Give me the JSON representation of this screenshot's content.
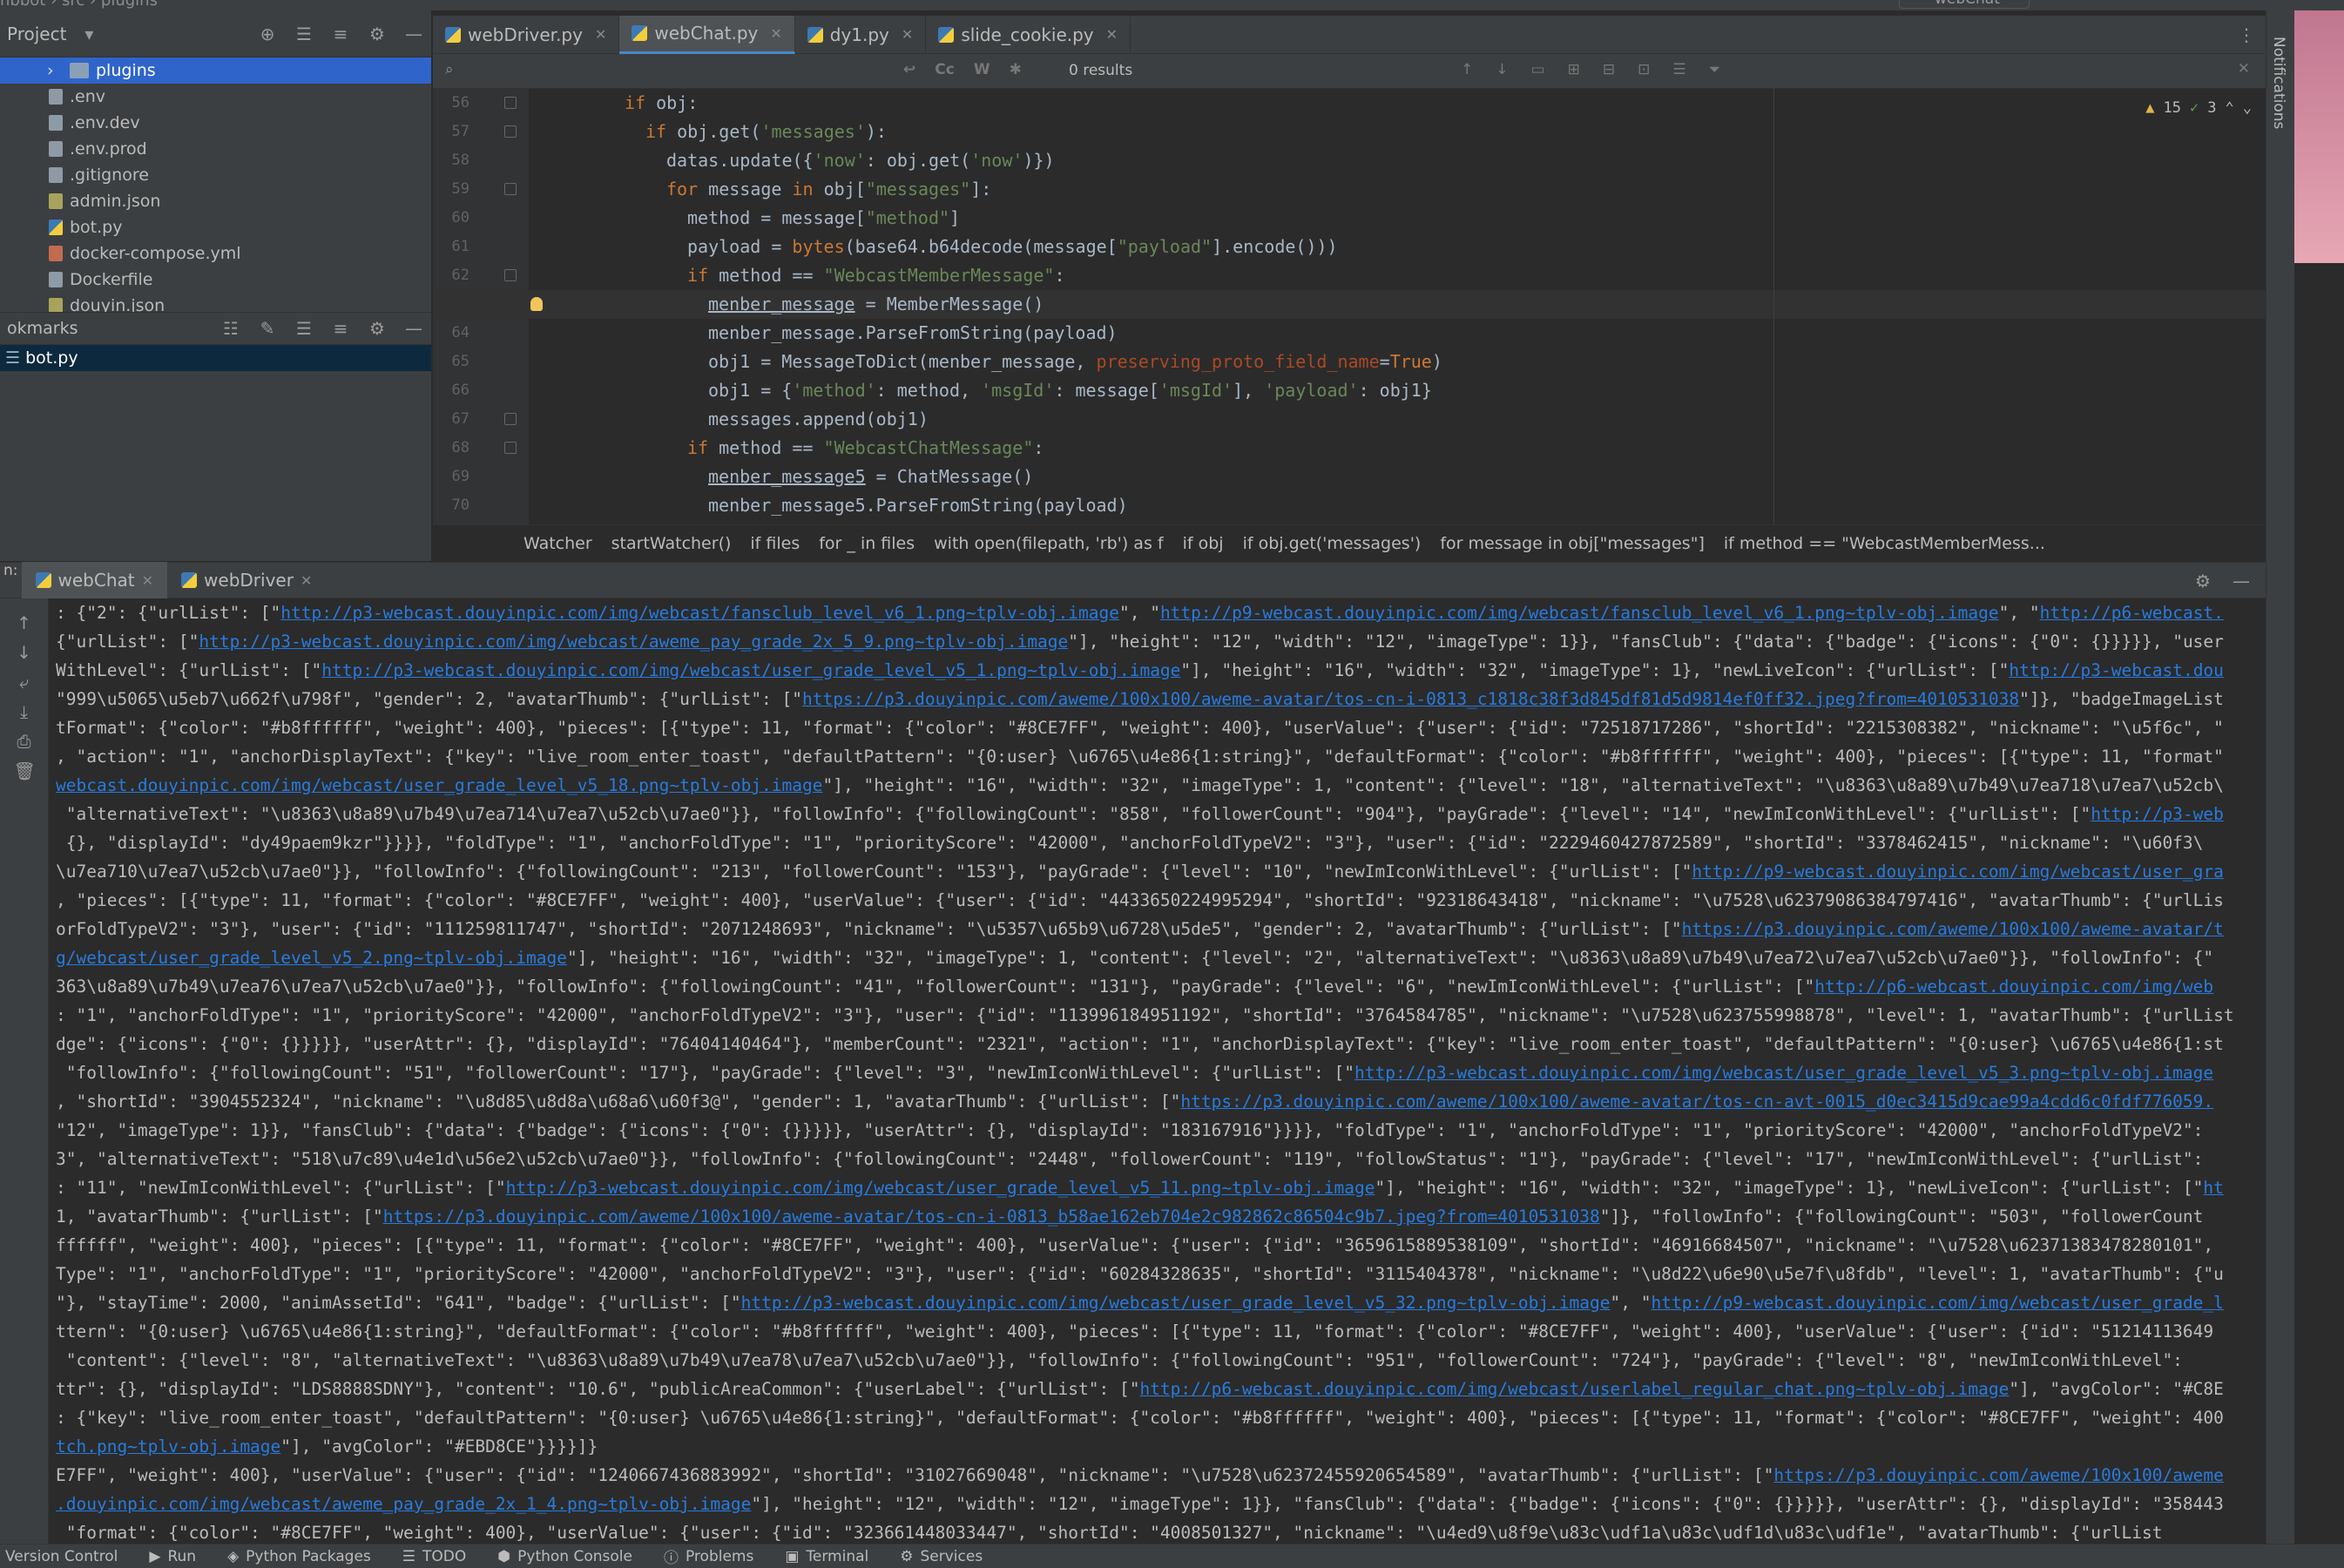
{
  "titlebar": {
    "breadcrumb": "nbbot  ›  src  ›  plugins",
    "run_config": "webChat"
  },
  "project": {
    "title": "Project",
    "items": [
      {
        "label": "plugins",
        "type": "folder",
        "selected": true
      },
      {
        "label": ".env",
        "type": "file"
      },
      {
        "label": ".env.dev",
        "type": "file"
      },
      {
        "label": ".env.prod",
        "type": "file"
      },
      {
        "label": ".gitignore",
        "type": "file"
      },
      {
        "label": "admin.json",
        "type": "json"
      },
      {
        "label": "bot.py",
        "type": "py"
      },
      {
        "label": "docker-compose.yml",
        "type": "yml"
      },
      {
        "label": "Dockerfile",
        "type": "file"
      },
      {
        "label": "douyin.json",
        "type": "json"
      }
    ]
  },
  "bookmarks": {
    "title": "okmarks",
    "items": [
      {
        "label": "bot.py"
      }
    ]
  },
  "editor": {
    "tabs": [
      {
        "label": "webDriver.py",
        "active": false
      },
      {
        "label": "webChat.py",
        "active": true
      },
      {
        "label": "dy1.py",
        "active": false
      },
      {
        "label": "slide_cookie.py",
        "active": false
      }
    ],
    "search": {
      "results": "0 results",
      "opt_cc": "Cc",
      "opt_w": "W"
    },
    "inspections": {
      "warnings": "15",
      "ok": "3"
    },
    "current_line": "63",
    "lines": [
      {
        "n": "56",
        "indent": 8,
        "html": "<span class=\"kw\">if</span> obj:"
      },
      {
        "n": "57",
        "indent": 10,
        "html": "<span class=\"kw\">if</span> obj.get(<span class=\"st\">'messages'</span>):"
      },
      {
        "n": "58",
        "indent": 12,
        "html": "datas.update({<span class=\"st\">'now'</span>: obj.get(<span class=\"st\">'now'</span>)})"
      },
      {
        "n": "59",
        "indent": 12,
        "html": "<span class=\"kw\">for</span> message <span class=\"kw\">in</span> obj[<span class=\"st\">\"messages\"</span>]:"
      },
      {
        "n": "60",
        "indent": 14,
        "html": "method = message[<span class=\"st\">\"method\"</span>]"
      },
      {
        "n": "61",
        "indent": 14,
        "html": "payload = <span class=\"kw\">bytes</span>(base64.b64decode(message[<span class=\"st\">\"payload\"</span>].encode()))"
      },
      {
        "n": "62",
        "indent": 14,
        "html": "<span class=\"kw\">if</span> method == <span class=\"st\">\"WebcastMemberMessage\"</span>:"
      },
      {
        "n": "63",
        "indent": 16,
        "html": "<span class=\"ul\">menber_message</span> = MemberMessage()"
      },
      {
        "n": "64",
        "indent": 16,
        "html": "menber_message.ParseFromString(payload)"
      },
      {
        "n": "65",
        "indent": 16,
        "html": "obj1 = MessageToDict(menber_message, <span class=\"pm\">preserving_proto_field_name</span>=<span class=\"kw\">True</span>)"
      },
      {
        "n": "66",
        "indent": 16,
        "html": "obj1 = {<span class=\"st\">'method'</span>: method, <span class=\"st\">'msgId'</span>: message[<span class=\"st\">'msgId'</span>], <span class=\"st\">'payload'</span>: obj1}"
      },
      {
        "n": "67",
        "indent": 16,
        "html": "messages.append(obj1)"
      },
      {
        "n": "68",
        "indent": 14,
        "html": "<span class=\"kw\">if</span> method == <span class=\"st\">\"WebcastChatMessage\"</span>:"
      },
      {
        "n": "69",
        "indent": 16,
        "html": "<span class=\"ul\">menber_message5</span> = ChatMessage()"
      },
      {
        "n": "70",
        "indent": 16,
        "html": "menber_message5.ParseFromString(payload)"
      }
    ],
    "breadcrumbs": [
      "Watcher",
      "startWatcher()",
      "if files",
      "for _ in files",
      "with open(filepath, 'rb') as f",
      "if obj",
      "if obj.get('messages')",
      "for message in obj[\"messages\"]",
      "if method == \"WebcastMemberMess..."
    ]
  },
  "run": {
    "prefix": "n:",
    "tabs": [
      {
        "label": "webChat",
        "active": true
      },
      {
        "label": "webDriver",
        "active": false
      }
    ],
    "console_lines": [
      ": {\"2\": {\"urlList\": [\"<a>http://p3-webcast.douyinpic.com/img/webcast/fansclub_level_v6_1.png~tplv-obj.image</a>\", \"<a>http://p9-webcast.douyinpic.com/img/webcast/fansclub_level_v6_1.png~tplv-obj.image</a>\", \"<a>http://p6-webcast.</a>",
      "{\"urlList\": [\"<a>http://p3-webcast.douyinpic.com/img/webcast/aweme_pay_grade_2x_5_9.png~tplv-obj.image</a>\"], \"height\": \"12\", \"width\": \"12\", \"imageType\": 1}}, \"fansClub\": {\"data\": {\"badge\": {\"icons\": {\"0\": {}}}}}, \"user",
      "WithLevel\": {\"urlList\": [\"<a>http://p3-webcast.douyinpic.com/img/webcast/user_grade_level_v5_1.png~tplv-obj.image</a>\"], \"height\": \"16\", \"width\": \"32\", \"imageType\": 1}, \"newLiveIcon\": {\"urlList\": [\"<a>http://p3-webcast.dou</a>",
      "\"999\\u5065\\u5eb7\\u662f\\u798f\", \"gender\": 2, \"avatarThumb\": {\"urlList\": [\"<a>https://p3.douyinpic.com/aweme/100x100/aweme-avatar/tos-cn-i-0813_c1818c38f3d845df81d5d9814ef0ff32.jpeg?from=4010531038</a>\"]}, \"badgeImageList",
      "tFormat\": {\"color\": \"#b8ffffff\", \"weight\": 400}, \"pieces\": [{\"type\": 11, \"format\": {\"color\": \"#8CE7FF\", \"weight\": 400}, \"userValue\": {\"user\": {\"id\": \"72518717286\", \"shortId\": \"2215308382\", \"nickname\": \"\\u5f6c\", \"",
      ", \"action\": \"1\", \"anchorDisplayText\": {\"key\": \"live_room_enter_toast\", \"defaultPattern\": \"{0:user} \\u6765\\u4e86{1:string}\", \"defaultFormat\": {\"color\": \"#b8ffffff\", \"weight\": 400}, \"pieces\": [{\"type\": 11, \"format\"",
      "<a>webcast.douyinpic.com/img/webcast/user_grade_level_v5_18.png~tplv-obj.image</a>\"], \"height\": \"16\", \"width\": \"32\", \"imageType\": 1, \"content\": {\"level\": \"18\", \"alternativeText\": \"\\u8363\\u8a89\\u7b49\\u7ea718\\u7ea7\\u52cb\\",
      " \"alternativeText\": \"\\u8363\\u8a89\\u7b49\\u7ea714\\u7ea7\\u52cb\\u7ae0\"}}, \"followInfo\": {\"followingCount\": \"858\", \"followerCount\": \"904\"}, \"payGrade\": {\"level\": \"14\", \"newImIconWithLevel\": {\"urlList\": [\"<a>http://p3-web</a>",
      " {}, \"displayId\": \"dy49paem9kzr\"}}}}, \"foldType\": \"1\", \"anchorFoldType\": \"1\", \"priorityScore\": \"42000\", \"anchorFoldTypeV2\": \"3\"}, \"user\": {\"id\": \"2229460427872589\", \"shortId\": \"3378462415\", \"nickname\": \"\\u60f3\\",
      "\\u7ea710\\u7ea7\\u52cb\\u7ae0\"}}, \"followInfo\": {\"followingCount\": \"213\", \"followerCount\": \"153\"}, \"payGrade\": {\"level\": \"10\", \"newImIconWithLevel\": {\"urlList\": [\"<a>http://p9-webcast.douyinpic.com/img/webcast/user_gra</a>",
      ", \"pieces\": [{\"type\": 11, \"format\": {\"color\": \"#8CE7FF\", \"weight\": 400}, \"userValue\": {\"user\": {\"id\": \"4433650224995294\", \"shortId\": \"92318643418\", \"nickname\": \"\\u7528\\u62379086384797416\", \"avatarThumb\": {\"urlLis",
      "orFoldTypeV2\": \"3\"}, \"user\": {\"id\": \"111259811747\", \"shortId\": \"2071248693\", \"nickname\": \"\\u5357\\u65b9\\u6728\\u5de5\", \"gender\": 2, \"avatarThumb\": {\"urlList\": [\"<a>https://p3.douyinpic.com/aweme/100x100/aweme-avatar/t</a>",
      "<a>g/webcast/user_grade_level_v5_2.png~tplv-obj.image</a>\"], \"height\": \"16\", \"width\": \"32\", \"imageType\": 1, \"content\": {\"level\": \"2\", \"alternativeText\": \"\\u8363\\u8a89\\u7b49\\u7ea72\\u7ea7\\u52cb\\u7ae0\"}}, \"followInfo\": {\"",
      "363\\u8a89\\u7b49\\u7ea76\\u7ea7\\u52cb\\u7ae0\"}}, \"followInfo\": {\"followingCount\": \"41\", \"followerCount\": \"131\"}, \"payGrade\": {\"level\": \"6\", \"newImIconWithLevel\": {\"urlList\": [\"<a>http://p6-webcast.douyinpic.com/img/web</a>",
      ": \"1\", \"anchorFoldType\": \"1\", \"priorityScore\": \"42000\", \"anchorFoldTypeV2\": \"3\"}, \"user\": {\"id\": \"113996184951192\", \"shortId\": \"3764584785\", \"nickname\": \"\\u7528\\u623755998878\", \"level\": 1, \"avatarThumb\": {\"urlList",
      "dge\": {\"icons\": {\"0\": {}}}}}, \"userAttr\": {}, \"displayId\": \"76404140464\"}, \"memberCount\": \"2321\", \"action\": \"1\", \"anchorDisplayText\": {\"key\": \"live_room_enter_toast\", \"defaultPattern\": \"{0:user} \\u6765\\u4e86{1:st",
      " \"followInfo\": {\"followingCount\": \"51\", \"followerCount\": \"17\"}, \"payGrade\": {\"level\": \"3\", \"newImIconWithLevel\": {\"urlList\": [\"<a>http://p3-webcast.douyinpic.com/img/webcast/user_grade_level_v5_3.png~tplv-obj.image</a>",
      ", \"shortId\": \"3904552324\", \"nickname\": \"\\u8d85\\u8d8a\\u68a6\\u60f3@\", \"gender\": 1, \"avatarThumb\": {\"urlList\": [\"<a>https://p3.douyinpic.com/aweme/100x100/aweme-avatar/tos-cn-avt-0015_d0ec3415d9cae99a4cdd6c0fdf776059.</a>",
      "\"12\", \"imageType\": 1}}, \"fansClub\": {\"data\": {\"badge\": {\"icons\": {\"0\": {}}}}}, \"userAttr\": {}, \"displayId\": \"183167916\"}}}}, \"foldType\": \"1\", \"anchorFoldType\": \"1\", \"priorityScore\": \"42000\", \"anchorFoldTypeV2\":",
      "3\", \"alternativeText\": \"518\\u7c89\\u4e1d\\u56e2\\u52cb\\u7ae0\"}}, \"followInfo\": {\"followingCount\": \"2448\", \"followerCount\": \"119\", \"followStatus\": \"1\"}, \"payGrade\": {\"level\": \"17\", \"newImIconWithLevel\": {\"urlList\":",
      ": \"11\", \"newImIconWithLevel\": {\"urlList\": [\"<a>http://p3-webcast.douyinpic.com/img/webcast/user_grade_level_v5_11.png~tplv-obj.image</a>\"], \"height\": \"16\", \"width\": \"32\", \"imageType\": 1}, \"newLiveIcon\": {\"urlList\": [\"<a>ht</a>",
      "1, \"avatarThumb\": {\"urlList\": [\"<a>https://p3.douyinpic.com/aweme/100x100/aweme-avatar/tos-cn-i-0813_b58ae162eb704e2c982862c86504c9b7.jpeg?from=4010531038</a>\"]}, \"followInfo\": {\"followingCount\": \"503\", \"followerCount",
      "ffffff\", \"weight\": 400}, \"pieces\": [{\"type\": 11, \"format\": {\"color\": \"#8CE7FF\", \"weight\": 400}, \"userValue\": {\"user\": {\"id\": \"3659615889538109\", \"shortId\": \"46916684507\", \"nickname\": \"\\u7528\\u62371383478280101\",",
      "Type\": \"1\", \"anchorFoldType\": \"1\", \"priorityScore\": \"42000\", \"anchorFoldTypeV2\": \"3\"}, \"user\": {\"id\": \"60284328635\", \"shortId\": \"3115404378\", \"nickname\": \"\\u8d22\\u6e90\\u5e7f\\u8fdb\", \"level\": 1, \"avatarThumb\": {\"u",
      "\"}, \"stayTime\": 2000, \"animAssetId\": \"641\", \"badge\": {\"urlList\": [\"<a>http://p3-webcast.douyinpic.com/img/webcast/user_grade_level_v5_32.png~tplv-obj.image</a>\", \"<a>http://p9-webcast.douyinpic.com/img/webcast/user_grade_l</a>",
      "ttern\": \"{0:user} \\u6765\\u4e86{1:string}\", \"defaultFormat\": {\"color\": \"#b8ffffff\", \"weight\": 400}, \"pieces\": [{\"type\": 11, \"format\": {\"color\": \"#8CE7FF\", \"weight\": 400}, \"userValue\": {\"user\": {\"id\": \"51214113649",
      " \"content\": {\"level\": \"8\", \"alternativeText\": \"\\u8363\\u8a89\\u7b49\\u7ea78\\u7ea7\\u52cb\\u7ae0\"}}, \"followInfo\": {\"followingCount\": \"951\", \"followerCount\": \"724\"}, \"payGrade\": {\"level\": \"8\", \"newImIconWithLevel\":",
      "ttr\": {}, \"displayId\": \"LDS8888SDNY\"}, \"content\": \"10.6\", \"publicAreaCommon\": {\"userLabel\": {\"urlList\": [\"<a>http://p6-webcast.douyinpic.com/img/webcast/userlabel_regular_chat.png~tplv-obj.image</a>\"], \"avgColor\": \"#C8E",
      ": {\"key\": \"live_room_enter_toast\", \"defaultPattern\": \"{0:user} \\u6765\\u4e86{1:string}\", \"defaultFormat\": {\"color\": \"#b8ffffff\", \"weight\": 400}, \"pieces\": [{\"type\": 11, \"format\": {\"color\": \"#8CE7FF\", \"weight\": 400",
      "<a>tch.png~tplv-obj.image</a>\"], \"avgColor\": \"#EBD8CE\"}}}}]}",
      "E7FF\", \"weight\": 400}, \"userValue\": {\"user\": {\"id\": \"1240667436883992\", \"shortId\": \"31027669048\", \"nickname\": \"\\u7528\\u62372455920654589\", \"avatarThumb\": {\"urlList\": [\"<a>https://p3.douyinpic.com/aweme/100x100/aweme</a>",
      "<a>.douyinpic.com/img/webcast/aweme_pay_grade_2x_1_4.png~tplv-obj.image</a>\"], \"height\": \"12\", \"width\": \"12\", \"imageType\": 1}}, \"fansClub\": {\"data\": {\"badge\": {\"icons\": {\"0\": {}}}}}, \"userAttr\": {}, \"displayId\": \"358443",
      " \"format\": {\"color\": \"#8CE7FF\", \"weight\": 400}, \"userValue\": {\"user\": {\"id\": \"323661448033447\", \"shortId\": \"4008501327\", \"nickname\": \"\\u4ed9\\u8f9e\\u83c\\udf1a\\u83c\\udf1d\\u83c\\udf1e\", \"avatarThumb\": {\"urlList"
    ]
  },
  "right_strip": {
    "label": "Notifications"
  },
  "statusbar": {
    "items": [
      "Version Control",
      "Run",
      "Python Packages",
      "TODO",
      "Python Console",
      "Problems",
      "Terminal",
      "Services"
    ]
  },
  "colors": {
    "accent": "#2f65ca",
    "link": "#287bde",
    "keyword": "#cc7832",
    "string": "#6a8759"
  }
}
